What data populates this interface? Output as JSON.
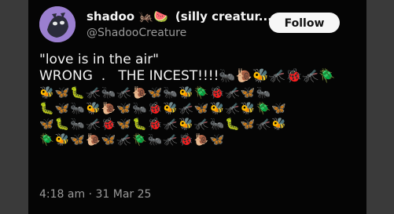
{
  "tweet": {
    "display_name": "shadoo",
    "name_suffix": "(silly creatur...",
    "name_emojis": "🦗🍉",
    "handle": "@ShadooCreature",
    "follow_label": "Follow",
    "text_line1": "\"love is in the air\"",
    "text_line2": "WRONG  .   THE INCEST!!!!",
    "text_line2_emojis": "🐜🐌🐝🦟🐞🦟🪲",
    "emoji_rows": [
      "🐝🦋🐛🦟🐜🦟🐌🦋🐜🐝🪲🐞🦟🦋🐜",
      "🐛🦋🐜🐝🐌🦋🐜🐞🐝🦟🦋🐝🦟🐝🪲🦋",
      "🦋🐛🐜🦟🐞🦋🐛🐞🦟🐝🦟🐜🐛🦋🦟🐝",
      "🪲🐝🦋🐌🦋🦟🪲🐜🦟🐞🐌🦋"
    ],
    "time": "4:18 am",
    "date": "31 Mar 25",
    "time_separator": "·"
  }
}
